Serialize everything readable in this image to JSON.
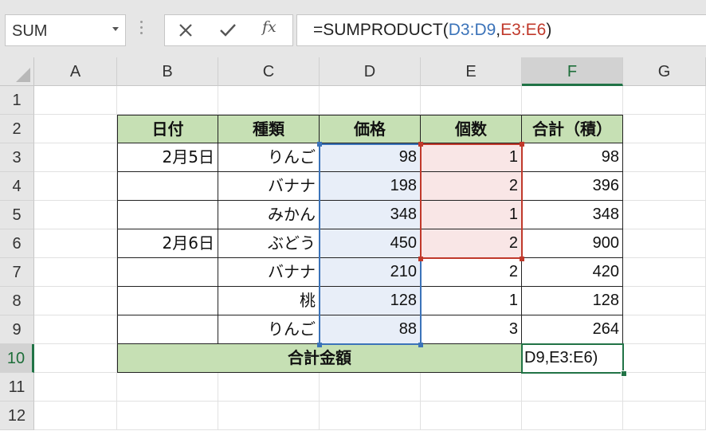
{
  "name_box": {
    "value": "SUM"
  },
  "formula_bar": {
    "prefix": "=SUMPRODUCT(",
    "ref1": "D3:D9",
    "comma": ",",
    "ref2": "E3:E6",
    "suffix": ")"
  },
  "columns": [
    "A",
    "B",
    "C",
    "D",
    "E",
    "F",
    "G"
  ],
  "active_column": "F",
  "rows": [
    "1",
    "2",
    "3",
    "4",
    "5",
    "6",
    "7",
    "8",
    "9",
    "10",
    "11",
    "12"
  ],
  "active_row": "10",
  "table": {
    "headers": [
      "日付",
      "種類",
      "価格",
      "個数",
      "合計（積）"
    ],
    "rows": [
      {
        "date": "2月5日",
        "kind": "りんご",
        "price": "98",
        "qty": "1",
        "total": "98"
      },
      {
        "date": "",
        "kind": "バナナ",
        "price": "198",
        "qty": "2",
        "total": "396"
      },
      {
        "date": "",
        "kind": "みかん",
        "price": "348",
        "qty": "1",
        "total": "348"
      },
      {
        "date": "2月6日",
        "kind": "ぶどう",
        "price": "450",
        "qty": "2",
        "total": "900"
      },
      {
        "date": "",
        "kind": "バナナ",
        "price": "210",
        "qty": "2",
        "total": "420"
      },
      {
        "date": "",
        "kind": "桃",
        "price": "128",
        "qty": "1",
        "total": "128"
      },
      {
        "date": "",
        "kind": "りんご",
        "price": "88",
        "qty": "3",
        "total": "264"
      }
    ],
    "total_label": "合計金額",
    "active_cell_text": "D9,E3:E6)"
  },
  "colors": {
    "header_fill": "#c6e0b4",
    "ref_blue": "#3b73b9",
    "ref_red": "#c0392b",
    "excel_green": "#217346"
  },
  "icons": {
    "cancel": "close-icon",
    "enter": "check-icon",
    "function": "fx-icon"
  }
}
